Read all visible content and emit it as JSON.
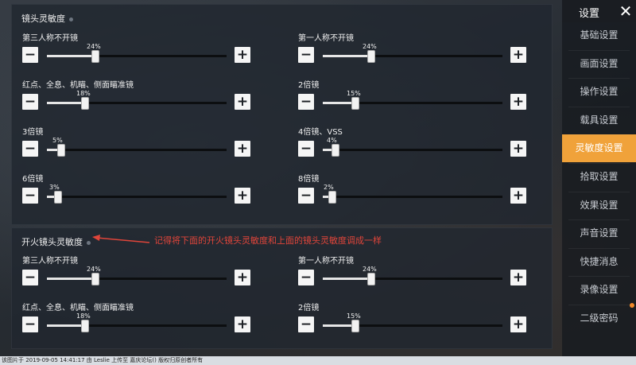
{
  "lens_section": {
    "title": "镜头灵敏度",
    "items": [
      {
        "label": "第三人称不开镜",
        "value": 24,
        "value_text": "24%"
      },
      {
        "label": "第一人称不开镜",
        "value": 24,
        "value_text": "24%"
      },
      {
        "label": "红点、全息、机瞄、侧面瞄准镜",
        "value": 18,
        "value_text": "18%"
      },
      {
        "label": "2倍镜",
        "value": 15,
        "value_text": "15%"
      },
      {
        "label": "3倍镜",
        "value": 5,
        "value_text": "5%"
      },
      {
        "label": "4倍镜、VSS",
        "value": 4,
        "value_text": "4%"
      },
      {
        "label": "6倍镜",
        "value": 3,
        "value_text": "3%"
      },
      {
        "label": "8倍镜",
        "value": 2,
        "value_text": "2%"
      }
    ]
  },
  "fire_section": {
    "title": "开火镜头灵敏度",
    "items": [
      {
        "label": "第三人称不开镜",
        "value": 24,
        "value_text": "24%"
      },
      {
        "label": "第一人称不开镜",
        "value": 24,
        "value_text": "24%"
      },
      {
        "label": "红点、全息、机瞄、侧面瞄准镜",
        "value": 18,
        "value_text": "18%"
      },
      {
        "label": "2倍镜",
        "value": 15,
        "value_text": "15%"
      }
    ]
  },
  "controls": {
    "minus": "−",
    "plus": "+"
  },
  "annotation": {
    "text": "记得将下面的开火镜头灵敏度和上面的镜头灵敏度调成一样",
    "color": "#e0453a"
  },
  "sidebar": {
    "title": "设置",
    "close": "✕",
    "items": [
      {
        "label": "基础设置"
      },
      {
        "label": "画面设置"
      },
      {
        "label": "操作设置"
      },
      {
        "label": "载具设置"
      },
      {
        "label": "灵敏度设置",
        "active": true
      },
      {
        "label": "拾取设置"
      },
      {
        "label": "效果设置"
      },
      {
        "label": "声音设置"
      },
      {
        "label": "快捷消息"
      },
      {
        "label": "录像设置"
      },
      {
        "label": "二级密码"
      }
    ]
  },
  "footer": {
    "text": "该图片于 2019-09-05 14:41:17 由 Leslie 上传至 嘉庆论坛() 版权归原创者所有"
  },
  "colors": {
    "accent": "#f0a23a",
    "annotation": "#e0453a"
  }
}
